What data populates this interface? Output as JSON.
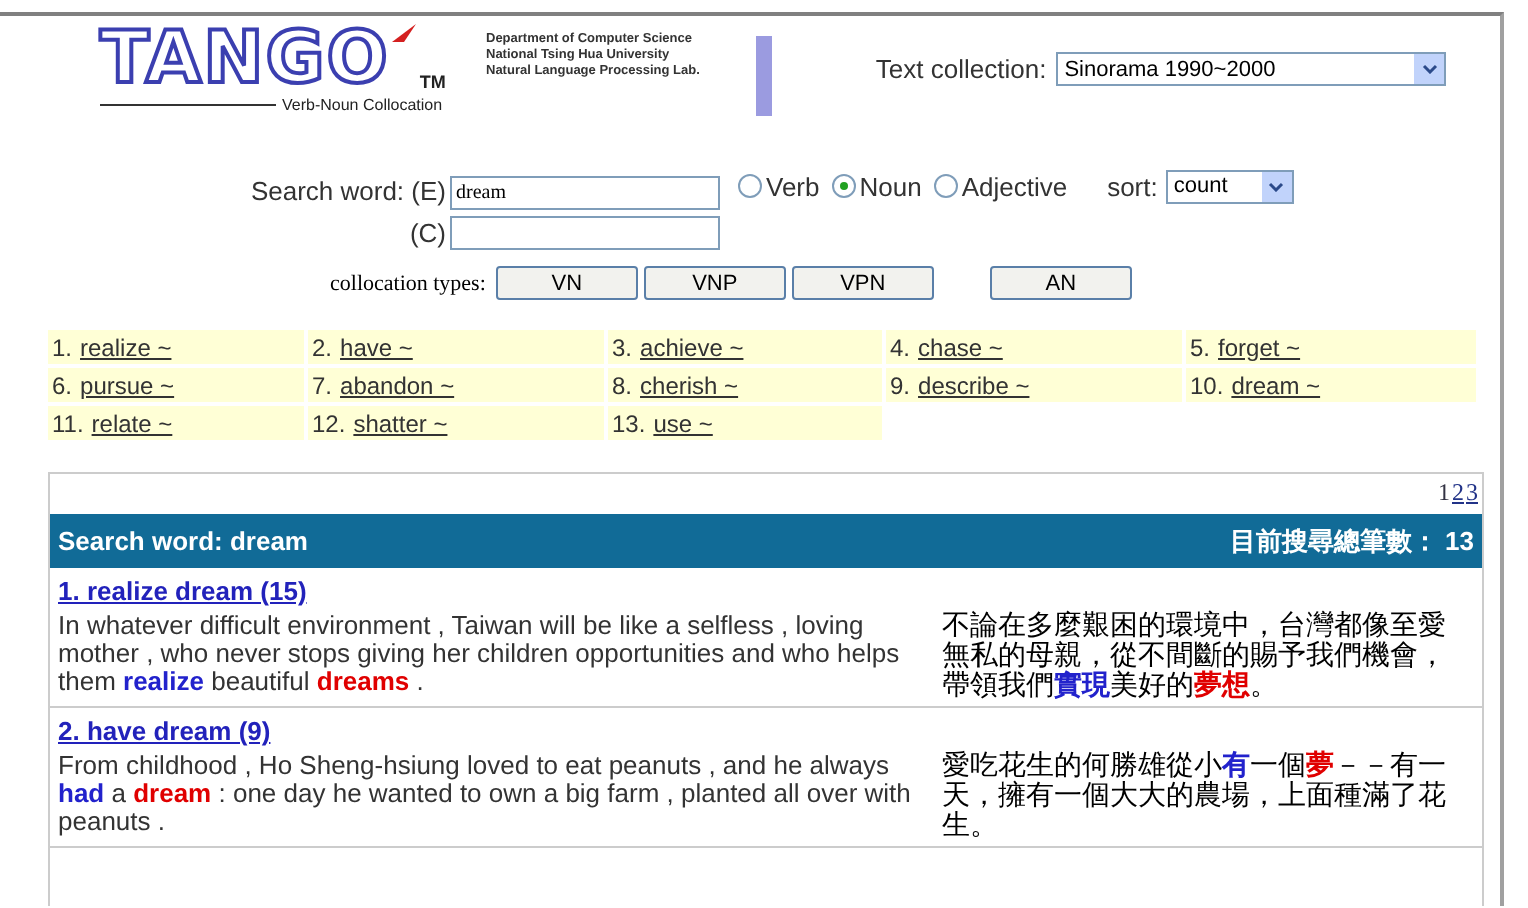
{
  "logo": {
    "title": "TANGO",
    "trademark": "TM",
    "subtitle": "Verb-Noun Collocation"
  },
  "department": [
    "Department of Computer Science",
    "National Tsing Hua University",
    "Natural Language Processing Lab."
  ],
  "text_collection": {
    "label": "Text collection:",
    "value": "Sinorama 1990~2000"
  },
  "search": {
    "label_e": "Search word: (E)",
    "value_e": "dream",
    "label_c": "(C)",
    "pos": [
      {
        "label": "Verb",
        "selected": false
      },
      {
        "label": "Noun",
        "selected": true
      },
      {
        "label": "Adjective",
        "selected": false
      }
    ],
    "sort_label": "sort:",
    "sort_value": "count"
  },
  "collocation_types": {
    "label": "collocation types:",
    "groups": [
      [
        "VN",
        "VNP",
        "VPN"
      ],
      [
        "AN"
      ]
    ]
  },
  "collocates": [
    {
      "number": "1.",
      "word": "realize ~"
    },
    {
      "number": "2.",
      "word": "have ~"
    },
    {
      "number": "3.",
      "word": "achieve ~"
    },
    {
      "number": "4.",
      "word": "chase ~"
    },
    {
      "number": "5.",
      "word": "forget ~"
    },
    {
      "number": "6.",
      "word": "pursue ~"
    },
    {
      "number": "7.",
      "word": "abandon ~"
    },
    {
      "number": "8.",
      "word": "cherish ~"
    },
    {
      "number": "9.",
      "word": "describe ~"
    },
    {
      "number": "10.",
      "word": "dream ~"
    },
    {
      "number": "11.",
      "word": "relate ~"
    },
    {
      "number": "12.",
      "word": "shatter ~"
    },
    {
      "number": "13.",
      "word": "use ~"
    }
  ],
  "pages": [
    {
      "label": "1",
      "selected": true
    },
    {
      "label": "2",
      "selected": false
    },
    {
      "label": "3",
      "selected": false
    }
  ],
  "results_header": {
    "search_word": "Search word: dream",
    "total": "目前搜尋總筆數： 13"
  },
  "results": [
    {
      "title": "1. realize dream (15)",
      "english": [
        {
          "kind": "plain",
          "text": "In whatever difficult environment , Taiwan will be like a selfless , loving mother , who never stops giving her children opportunities and who helps them "
        },
        {
          "kind": "verb",
          "text": "realize"
        },
        {
          "kind": "plain",
          "text": " beautiful "
        },
        {
          "kind": "noun",
          "text": "dreams"
        },
        {
          "kind": "plain",
          "text": " ."
        }
      ],
      "chinese": [
        {
          "kind": "plain",
          "text": "不論在多麼艱困的環境中，台灣都像至愛無私的母親，從不間斷的賜予我們機會，帶領我們"
        },
        {
          "kind": "verb",
          "text": "實現"
        },
        {
          "kind": "plain",
          "text": "美好的"
        },
        {
          "kind": "noun",
          "text": "夢想"
        },
        {
          "kind": "plain",
          "text": "。"
        }
      ]
    },
    {
      "title": "2. have dream (9)",
      "english": [
        {
          "kind": "plain",
          "text": "From childhood , Ho Sheng-hsiung loved to eat peanuts , and he always "
        },
        {
          "kind": "verb",
          "text": "had"
        },
        {
          "kind": "plain",
          "text": " a "
        },
        {
          "kind": "noun",
          "text": "dream"
        },
        {
          "kind": "plain",
          "text": " : one day he wanted to own a big farm , planted all over with peanuts ."
        }
      ],
      "chinese": [
        {
          "kind": "plain",
          "text": "愛吃花生的何勝雄從小"
        },
        {
          "kind": "verb",
          "text": "有"
        },
        {
          "kind": "plain",
          "text": "一個"
        },
        {
          "kind": "noun",
          "text": "夢"
        },
        {
          "kind": "plain",
          "text": "－－有一天，擁有一個大大的農場，上面種滿了花生。"
        }
      ]
    }
  ]
}
